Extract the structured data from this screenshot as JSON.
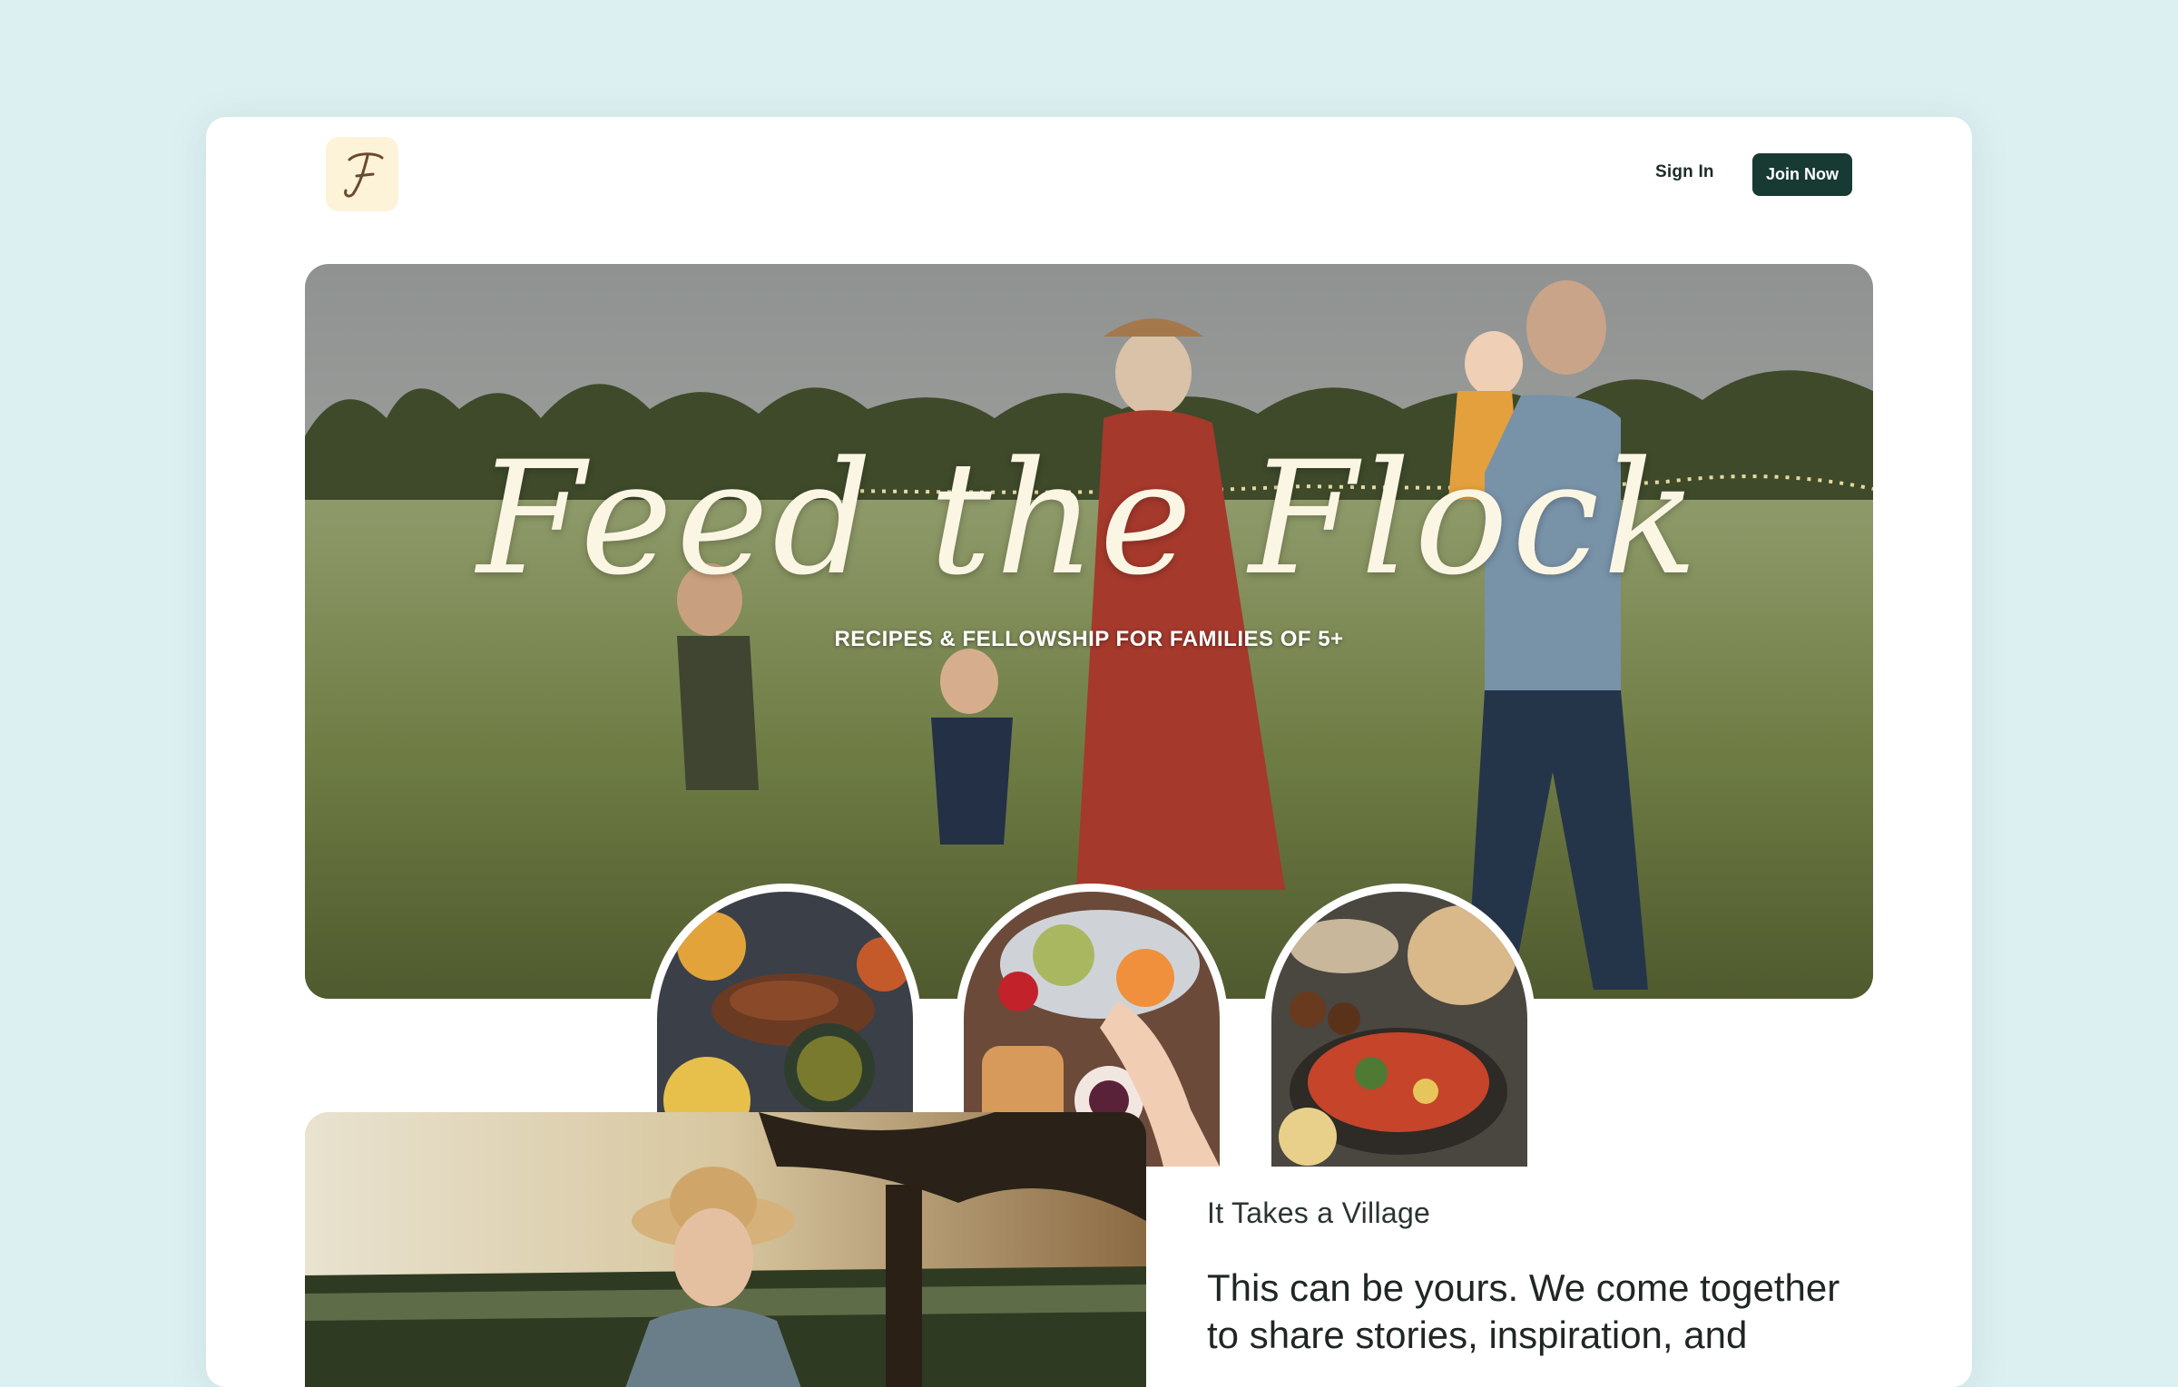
{
  "header": {
    "logo_letter": "F",
    "sign_in_label": "Sign In",
    "join_label": "Join Now"
  },
  "hero": {
    "title": "Feed the Flock",
    "subtitle": "RECIPES & FELLOWSHIP FOR FAMILIES OF 5+"
  },
  "village": {
    "kicker": "It Takes a Village",
    "body": "This can be yours. We come together to share stories, inspiration, and"
  },
  "colors": {
    "page_bg": "#dceff1",
    "join_button": "#173a33",
    "logo_bg": "#fdf3d8",
    "title_cream": "#fbf6e4"
  }
}
